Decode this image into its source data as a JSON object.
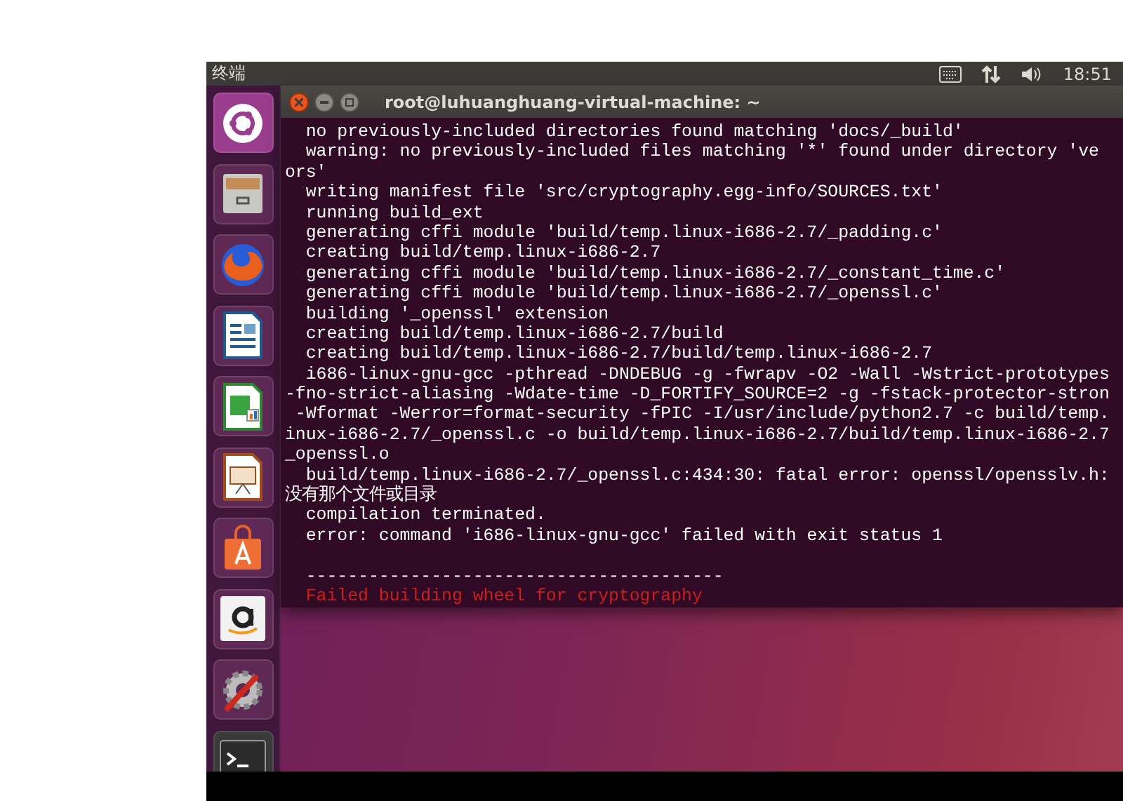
{
  "top_bar": {
    "app_title": "终端",
    "clock": "18:51"
  },
  "terminal": {
    "title": "root@luhuanghuang-virtual-machine: ~",
    "lines": [
      {
        "kind": "output",
        "text": "  no previously-included directories found matching 'docs/_build'"
      },
      {
        "kind": "output",
        "text": "  warning: no previously-included files matching '*' found under directory 've"
      },
      {
        "kind": "output",
        "text": "ors'"
      },
      {
        "kind": "output",
        "text": "  writing manifest file 'src/cryptography.egg-info/SOURCES.txt'"
      },
      {
        "kind": "output",
        "text": "  running build_ext"
      },
      {
        "kind": "output",
        "text": "  generating cffi module 'build/temp.linux-i686-2.7/_padding.c'"
      },
      {
        "kind": "output",
        "text": "  creating build/temp.linux-i686-2.7"
      },
      {
        "kind": "output",
        "text": "  generating cffi module 'build/temp.linux-i686-2.7/_constant_time.c'"
      },
      {
        "kind": "output",
        "text": "  generating cffi module 'build/temp.linux-i686-2.7/_openssl.c'"
      },
      {
        "kind": "output",
        "text": "  building '_openssl' extension"
      },
      {
        "kind": "output",
        "text": "  creating build/temp.linux-i686-2.7/build"
      },
      {
        "kind": "output",
        "text": "  creating build/temp.linux-i686-2.7/build/temp.linux-i686-2.7"
      },
      {
        "kind": "output",
        "text": "  i686-linux-gnu-gcc -pthread -DNDEBUG -g -fwrapv -O2 -Wall -Wstrict-prototypes"
      },
      {
        "kind": "output",
        "text": "-fno-strict-aliasing -Wdate-time -D_FORTIFY_SOURCE=2 -g -fstack-protector-stron"
      },
      {
        "kind": "output",
        "text": " -Wformat -Werror=format-security -fPIC -I/usr/include/python2.7 -c build/temp."
      },
      {
        "kind": "output",
        "text": "inux-i686-2.7/_openssl.c -o build/temp.linux-i686-2.7/build/temp.linux-i686-2.7"
      },
      {
        "kind": "output",
        "text": "_openssl.o"
      },
      {
        "kind": "output",
        "text": "  build/temp.linux-i686-2.7/_openssl.c:434:30: fatal error: openssl/opensslv.h:"
      },
      {
        "kind": "output",
        "text": "没有那个文件或目录"
      },
      {
        "kind": "output",
        "text": "  compilation terminated."
      },
      {
        "kind": "output",
        "text": "  error: command 'i686-linux-gnu-gcc' failed with exit status 1"
      },
      {
        "kind": "blank"
      },
      {
        "kind": "output",
        "text": "  ----------------------------------------"
      },
      {
        "kind": "error",
        "text": "  Failed building wheel for cryptography"
      }
    ]
  }
}
